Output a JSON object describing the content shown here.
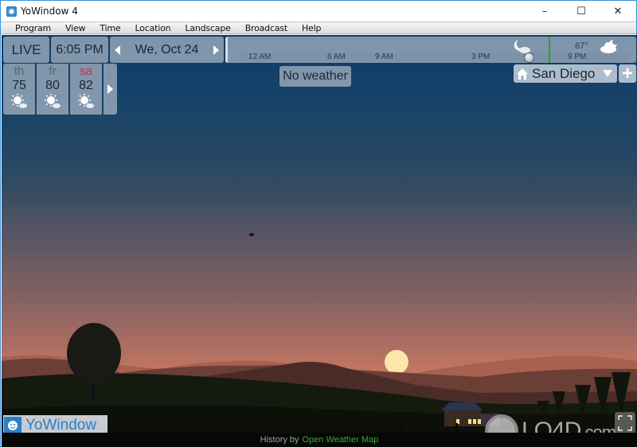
{
  "window": {
    "title": "YoWindow 4",
    "controls": {
      "minimize": "–",
      "maximize": "☐",
      "close": "✕"
    }
  },
  "menu": [
    "Program",
    "View",
    "Time",
    "Location",
    "Landscape",
    "Broadcast",
    "Help"
  ],
  "toolbar": {
    "live_label": "LIVE",
    "time": "6:05 PM",
    "date": "We, Oct 24"
  },
  "timeline": {
    "ticks": [
      "12 AM",
      "6 AM",
      "9 AM",
      "3 PM",
      "9 PM"
    ],
    "temperature": "67°",
    "now_marker_color": "#2ca02c"
  },
  "forecast": [
    {
      "day": "th",
      "temp": "75",
      "icon": "sunny-cloud-icon",
      "weekend": false
    },
    {
      "day": "fr",
      "temp": "80",
      "icon": "sunny-cloud-icon",
      "weekend": false
    },
    {
      "day": "sa",
      "temp": "82",
      "icon": "sunny-cloud-icon",
      "weekend": true
    }
  ],
  "status": {
    "no_weather": "No weather"
  },
  "location": {
    "name": "San Diego",
    "add_label": "+"
  },
  "brand": {
    "name": "YoWindow"
  },
  "footer": {
    "prefix": "History by",
    "link": "Open Weather Map"
  },
  "watermark": {
    "text": "LO4D",
    "suffix": ".com"
  }
}
